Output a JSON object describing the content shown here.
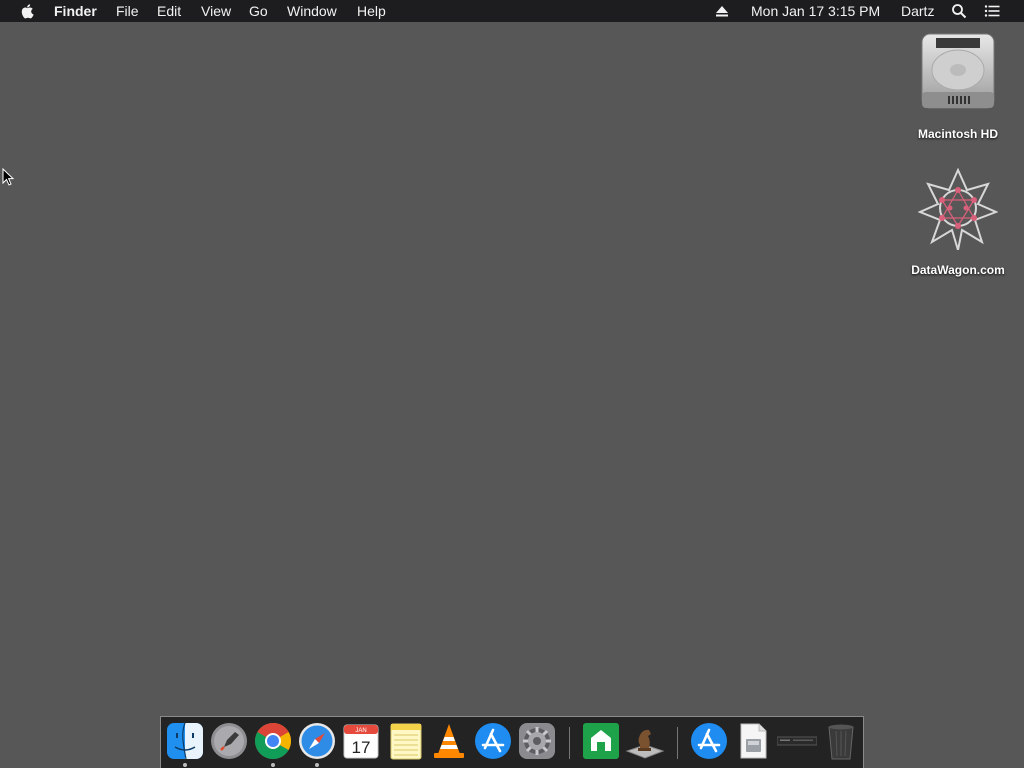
{
  "menubar": {
    "apple_icon": "apple-icon",
    "app_name": "Finder",
    "menus": [
      "File",
      "Edit",
      "View",
      "Go",
      "Window",
      "Help"
    ],
    "status": {
      "eject_icon": "eject-icon",
      "datetime": "Mon Jan 17  3:15 PM",
      "user": "Dartz",
      "search_icon": "spotlight-search-icon",
      "list_icon": "notification-center-icon"
    }
  },
  "desktop": {
    "icons": [
      {
        "label": "Macintosh HD",
        "icon": "hard-drive-icon"
      },
      {
        "label": "DataWagon.com",
        "icon": "datawagon-icon"
      }
    ]
  },
  "dock": {
    "items": [
      {
        "name": "Finder",
        "icon": "finder-icon",
        "running": true
      },
      {
        "name": "Launchpad",
        "icon": "launchpad-icon",
        "running": false
      },
      {
        "name": "Google Chrome",
        "icon": "chrome-icon",
        "running": true
      },
      {
        "name": "Safari",
        "icon": "safari-icon",
        "running": true
      },
      {
        "name": "Calendar",
        "icon": "calendar-icon",
        "running": false,
        "month": "JAN",
        "day": "17"
      },
      {
        "name": "Notes",
        "icon": "notes-icon",
        "running": false
      },
      {
        "name": "VLC",
        "icon": "vlc-icon",
        "running": false
      },
      {
        "name": "App Store",
        "icon": "app-store-icon",
        "running": false
      },
      {
        "name": "System Preferences",
        "icon": "system-preferences-icon",
        "running": false
      },
      {
        "name": "Green app",
        "icon": "green-app-icon",
        "running": false
      },
      {
        "name": "Chess",
        "icon": "chess-icon",
        "running": false
      },
      {
        "name": "App Store download",
        "icon": "app-store-download-icon",
        "running": false
      },
      {
        "name": "Document",
        "icon": "document-icon",
        "running": false
      },
      {
        "name": "Minimized window",
        "icon": "minimized-window-icon",
        "running": false
      },
      {
        "name": "Trash",
        "icon": "trash-icon",
        "running": false
      }
    ]
  },
  "colors": {
    "desktop_background": "#575757",
    "menubar_background": "#1d1d1f",
    "dock_background": "#1e1e20"
  }
}
